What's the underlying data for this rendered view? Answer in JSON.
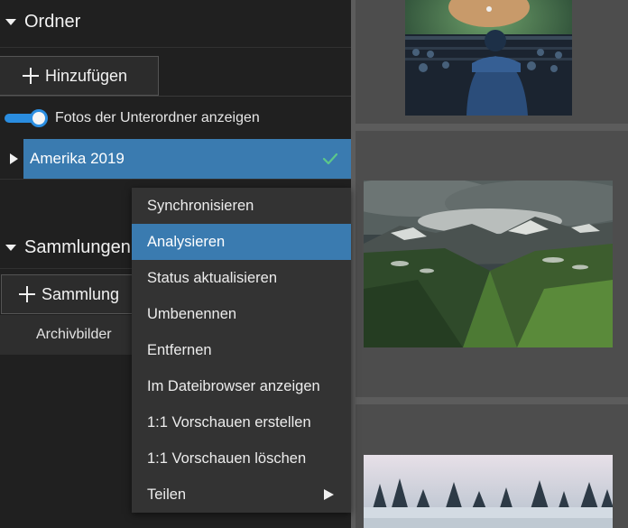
{
  "folders": {
    "header_title": "Ordner",
    "add_button_label": "Hinzufügen",
    "subfolder_toggle": {
      "label": "Fotos der Unterordner anzeigen",
      "enabled": true
    },
    "items": [
      {
        "name": "Amerika 2019",
        "selected": true,
        "synced": true
      }
    ]
  },
  "collections": {
    "header_title": "Sammlungen",
    "add_button_label": "Sammlung",
    "items": [
      {
        "name": "Archivbilder"
      }
    ]
  },
  "context_menu": {
    "highlighted": "Analysieren",
    "items": [
      {
        "label": "Synchronisieren"
      },
      {
        "label": "Analysieren"
      },
      {
        "label": "Status aktualisieren"
      },
      {
        "label": "Umbenennen"
      },
      {
        "label": "Entfernen"
      },
      {
        "label": "Im Dateibrowser anzeigen"
      },
      {
        "label": "1:1 Vorschauen erstellen"
      },
      {
        "label": "1:1 Vorschauen löschen"
      },
      {
        "label": "Teilen",
        "has_submenu": true
      }
    ]
  },
  "thumbnails": [
    {
      "subject": "baseball stadium at night"
    },
    {
      "subject": "mountain valley under storm clouds"
    },
    {
      "subject": "snowy forest landscape"
    }
  ],
  "colors": {
    "accent": "#3a7bb0",
    "toggle": "#2a8de0",
    "check": "#5cc78a"
  }
}
